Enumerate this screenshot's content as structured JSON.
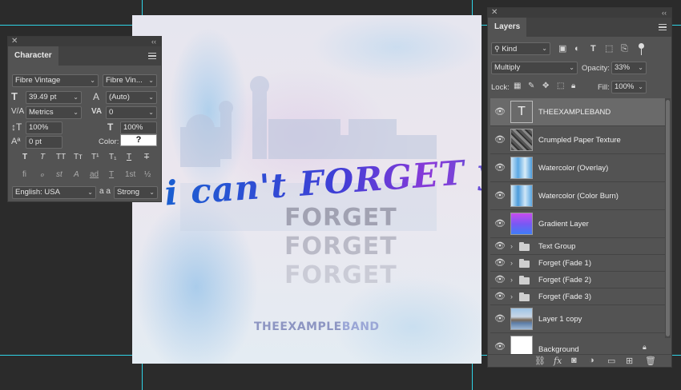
{
  "character_panel": {
    "title": "Character",
    "font_family": "Fibre Vintage",
    "font_style": "Fibre Vin...",
    "font_size": "39.49 pt",
    "leading": "(Auto)",
    "kerning": "Metrics",
    "tracking": "0",
    "vertical_scale": "100%",
    "horizontal_scale": "100%",
    "baseline_shift": "0 pt",
    "color_label": "Color:",
    "color_value": "?",
    "type_buttons": [
      "T",
      "T",
      "TT",
      "Tт",
      "T¹",
      "T₁",
      "T",
      "T"
    ],
    "opentype_buttons": [
      "fi",
      "ℴ",
      "st",
      "A",
      "ad",
      "T",
      "1st",
      "½"
    ],
    "language": "English: USA",
    "aa_label": "a a",
    "antialias": "Strong"
  },
  "artwork": {
    "title_text": "i can't FORGET you",
    "forget_echo": [
      "FORGET",
      "FORGET",
      "FORGET"
    ],
    "band_part1": "THEEXAMPLE",
    "band_part2": "BAND"
  },
  "layers_panel": {
    "title": "Layers",
    "filter_kind": "Kind",
    "blend_mode": "Multiply",
    "opacity_label": "Opacity:",
    "opacity_value": "33%",
    "lock_label": "Lock:",
    "fill_label": "Fill:",
    "fill_value": "100%",
    "layers": [
      {
        "name": "THEEXAMPLEBAND",
        "type": "text",
        "selected": true
      },
      {
        "name": "Crumpled Paper Texture",
        "type": "texture"
      },
      {
        "name": "Watercolor (Overlay)",
        "type": "watercolor"
      },
      {
        "name": "Watercolor (Color Burn)",
        "type": "watercolor"
      },
      {
        "name": "Gradient Layer",
        "type": "gradient"
      },
      {
        "name": "Text Group",
        "type": "group"
      },
      {
        "name": "Forget (Fade 1)",
        "type": "group"
      },
      {
        "name": "Forget (Fade 2)",
        "type": "group"
      },
      {
        "name": "Forget (Fade 3)",
        "type": "group"
      },
      {
        "name": "Layer 1 copy",
        "type": "photo"
      },
      {
        "name": "Background",
        "type": "background",
        "locked": true
      }
    ],
    "bottom_icons": [
      "link-icon",
      "fx-icon",
      "mask-icon",
      "adjustment-icon",
      "folder-icon",
      "new-layer-icon",
      "trash-icon"
    ],
    "fx_label": "fx"
  }
}
